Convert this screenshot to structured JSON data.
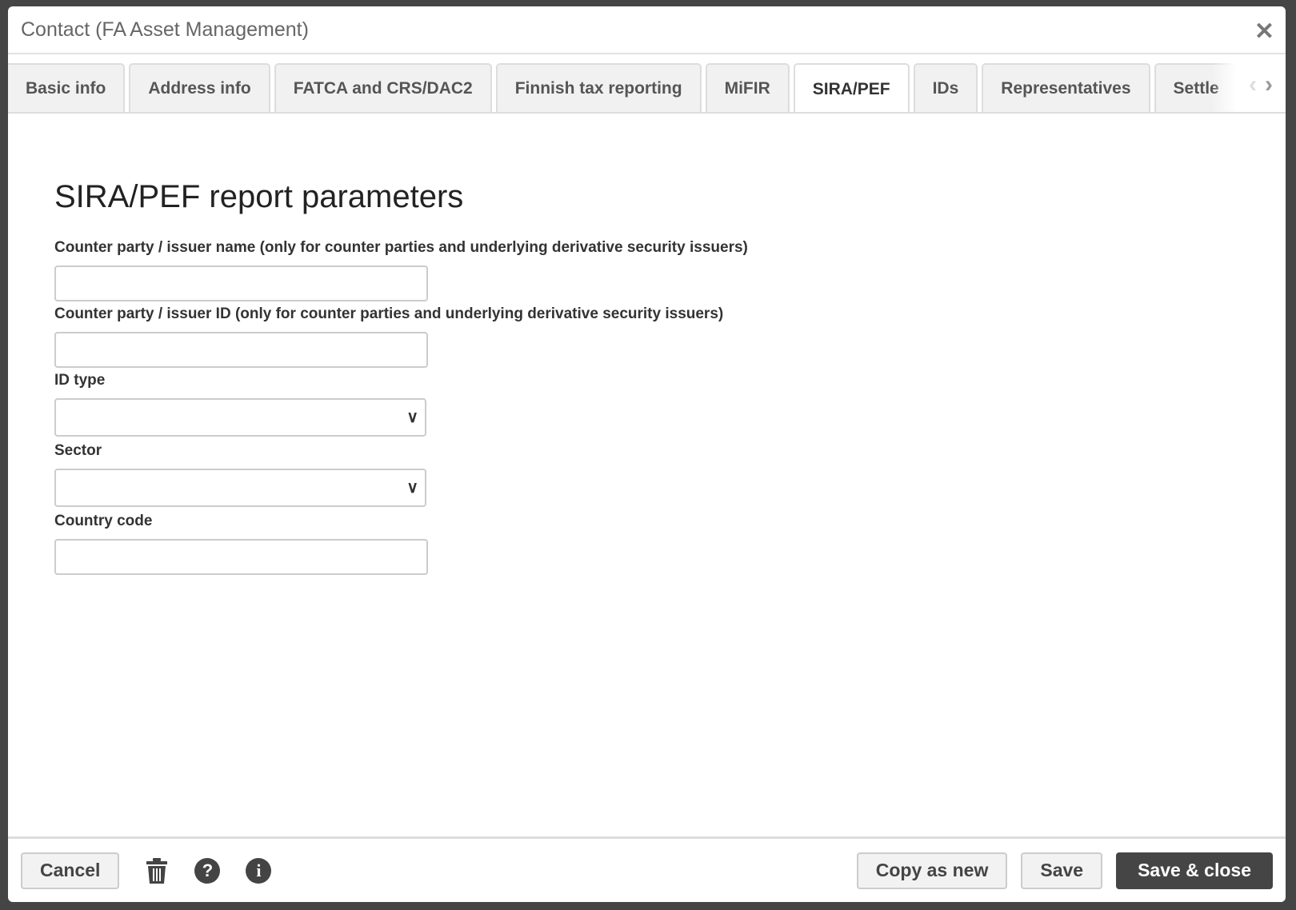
{
  "window": {
    "title": "Contact (FA Asset Management)",
    "close_icon": "close-icon"
  },
  "tabs": [
    {
      "label": "Basic info"
    },
    {
      "label": "Address info"
    },
    {
      "label": "FATCA and CRS/DAC2"
    },
    {
      "label": "Finnish tax reporting"
    },
    {
      "label": "MiFIR"
    },
    {
      "label": "SIRA/PEF",
      "active": true
    },
    {
      "label": "IDs"
    },
    {
      "label": "Representatives"
    },
    {
      "label": "Settle"
    }
  ],
  "form": {
    "heading": "SIRA/PEF report parameters",
    "fields": [
      {
        "label": "Counter party / issuer name (only for counter parties and underlying derivative security issuers)",
        "value": ""
      },
      {
        "label": "Counter party / issuer ID (only for counter parties and underlying derivative security issuers)",
        "value": ""
      },
      {
        "label": "ID type",
        "value": ""
      },
      {
        "label": "Sector",
        "value": ""
      },
      {
        "label": "Country code",
        "value": ""
      }
    ]
  },
  "footer": {
    "cancel": "Cancel",
    "copy_as_new": "Copy as new",
    "save": "Save",
    "save_close": "Save & close"
  }
}
